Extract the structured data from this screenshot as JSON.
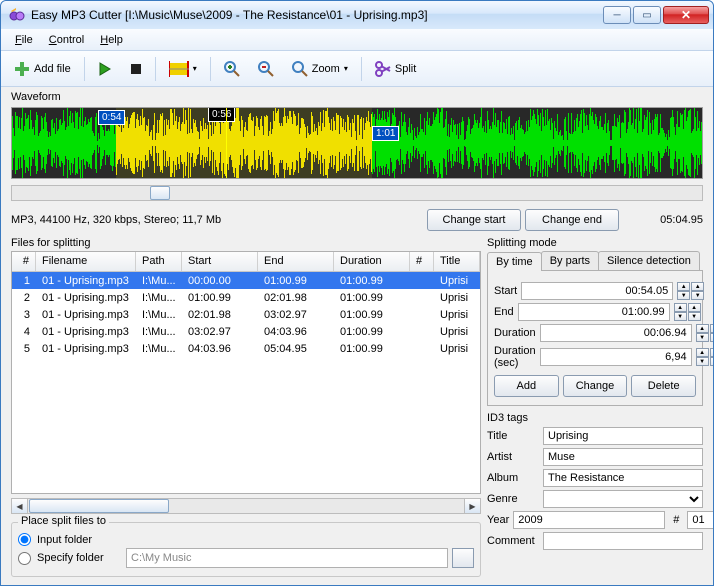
{
  "window": {
    "title": "Easy MP3 Cutter [I:\\Music\\Muse\\2009 - The Resistance\\01 - Uprising.mp3]"
  },
  "menu": {
    "file": "File",
    "control": "Control",
    "help": "Help"
  },
  "toolbar": {
    "add": "Add file",
    "zoom": "Zoom",
    "split": "Split"
  },
  "waveform": {
    "label": "Waveform",
    "marker_start": "0:54",
    "marker_mid": "0:56",
    "marker_end": "1:01"
  },
  "info": {
    "text": "MP3, 44100 Hz, 320 kbps, Stereo; 11,7 Mb",
    "change_start": "Change start",
    "change_end": "Change end",
    "total": "05:04.95"
  },
  "files": {
    "label": "Files for splitting",
    "headers": {
      "idx": "#",
      "fn": "Filename",
      "path": "Path",
      "start": "Start",
      "end": "End",
      "dur": "Duration",
      "n": "#",
      "title": "Title"
    },
    "rows": [
      {
        "idx": "1",
        "fn": "01 - Uprising.mp3",
        "path": "I:\\Mu...",
        "start": "00:00.00",
        "end": "01:00.99",
        "dur": "01:00.99",
        "n": "",
        "title": "Uprisi"
      },
      {
        "idx": "2",
        "fn": "01 - Uprising.mp3",
        "path": "I:\\Mu...",
        "start": "01:00.99",
        "end": "02:01.98",
        "dur": "01:00.99",
        "n": "",
        "title": "Uprisi"
      },
      {
        "idx": "3",
        "fn": "01 - Uprising.mp3",
        "path": "I:\\Mu...",
        "start": "02:01.98",
        "end": "03:02.97",
        "dur": "01:00.99",
        "n": "",
        "title": "Uprisi"
      },
      {
        "idx": "4",
        "fn": "01 - Uprising.mp3",
        "path": "I:\\Mu...",
        "start": "03:02.97",
        "end": "04:03.96",
        "dur": "01:00.99",
        "n": "",
        "title": "Uprisi"
      },
      {
        "idx": "5",
        "fn": "01 - Uprising.mp3",
        "path": "I:\\Mu...",
        "start": "04:03.96",
        "end": "05:04.95",
        "dur": "01:00.99",
        "n": "",
        "title": "Uprisi"
      }
    ]
  },
  "dest": {
    "label": "Place split files to",
    "input_folder": "Input folder",
    "specify_folder": "Specify folder",
    "path": "C:\\My Music"
  },
  "split": {
    "label": "Splitting mode",
    "tabs": {
      "bytime": "By time",
      "byparts": "By parts",
      "silence": "Silence detection"
    },
    "start_lbl": "Start",
    "start": "00:54.05",
    "end_lbl": "End",
    "end": "01:00.99",
    "dur_lbl": "Duration",
    "dur": "00:06.94",
    "dursec_lbl": "Duration (sec)",
    "dursec": "6,94",
    "add": "Add",
    "change": "Change",
    "delete": "Delete"
  },
  "id3": {
    "label": "ID3 tags",
    "title_lbl": "Title",
    "title": "Uprising",
    "artist_lbl": "Artist",
    "artist": "Muse",
    "album_lbl": "Album",
    "album": "The Resistance",
    "genre_lbl": "Genre",
    "genre": "",
    "year_lbl": "Year",
    "year": "2009",
    "track_lbl": "#",
    "track": "01",
    "comment_lbl": "Comment",
    "comment": ""
  }
}
